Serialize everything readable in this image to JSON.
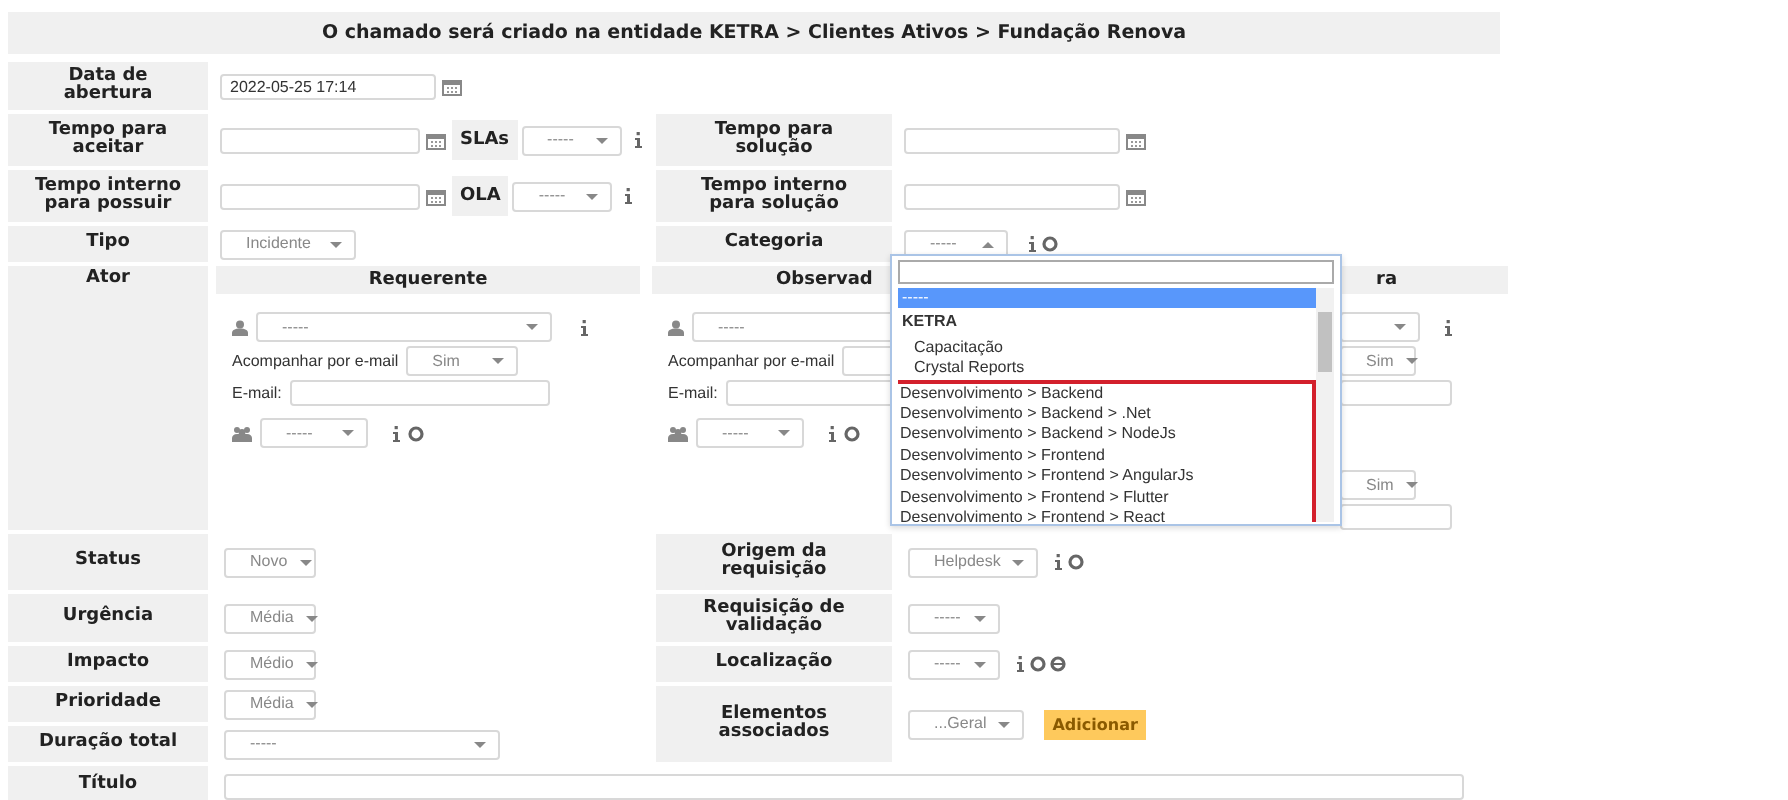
{
  "banner": "O chamado será criado na entidade KETRA > Clientes Ativos > Fundação Renova",
  "opening": {
    "label": "Data de abertura",
    "value": "2022-05-25 17:14"
  },
  "time_rows": [
    {
      "label": "Tempo para aceitar",
      "tag": "SLAs",
      "select": "-----",
      "right_label": "Tempo para solução"
    },
    {
      "label": "Tempo interno para possuir",
      "tag": "OLA",
      "select": "-----",
      "right_label": "Tempo interno para solução"
    }
  ],
  "type": {
    "label": "Tipo",
    "value": "Incidente"
  },
  "category": {
    "label": "Categoria",
    "value": "-----",
    "expanded": true
  },
  "actors": {
    "label": "Ator",
    "columns": [
      {
        "heading": "Requerente",
        "user_select": "-----",
        "follow_label": "Acompanhar por e-mail",
        "follow_value": "Sim",
        "email_label": "E-mail:",
        "group_select": "-----"
      },
      {
        "heading": "Observad",
        "user_select": "-----",
        "follow_label": "Acompanhar por e-mail",
        "email_label": "E-mail:",
        "group_select": "-----"
      },
      {
        "heading": "ra",
        "follow_values": [
          "Sim",
          "Sim"
        ]
      }
    ]
  },
  "left_fields": [
    {
      "label": "Status",
      "value": "Novo",
      "kind": "short"
    },
    {
      "label": "Urgência",
      "value": "Média",
      "kind": "short"
    },
    {
      "label": "Impacto",
      "value": "Médio",
      "kind": "short"
    },
    {
      "label": "Prioridade",
      "value": "Média",
      "kind": "short"
    },
    {
      "label": "Duração total",
      "value": "-----",
      "kind": "wide"
    }
  ],
  "right_fields": [
    {
      "label": "Origem da requisição",
      "value": "Helpdesk",
      "kind": "actions"
    },
    {
      "label": "Requisição de validação",
      "value": "-----",
      "kind": "plain"
    },
    {
      "label": "Localização",
      "value": "-----",
      "kind": "location"
    },
    {
      "label": "Elementos associados",
      "value": "...Geral",
      "kind": "button",
      "button": "Adicionar"
    }
  ],
  "title_label": "Título",
  "dropdown": {
    "options": [
      {
        "text": "-----",
        "kind": "empty",
        "selected": true,
        "outlined": false
      },
      {
        "text": "KETRA",
        "kind": "group",
        "selected": false,
        "outlined": false
      },
      {
        "text": "Capacitação",
        "kind": "option",
        "selected": false,
        "outlined": false
      },
      {
        "text": "Crystal Reports",
        "kind": "option",
        "selected": false,
        "outlined": false
      },
      {
        "text": "Desenvolvimento > Backend",
        "kind": "option",
        "selected": false,
        "outlined": true
      },
      {
        "text": "Desenvolvimento > Backend > .Net",
        "kind": "option",
        "selected": false,
        "outlined": true
      },
      {
        "text": "Desenvolvimento > Backend > NodeJs",
        "kind": "option",
        "selected": false,
        "outlined": true
      },
      {
        "text": "Desenvolvimento > Frontend",
        "kind": "option",
        "selected": false,
        "outlined": true
      },
      {
        "text": "Desenvolvimento > Frontend > AngularJs",
        "kind": "option",
        "selected": false,
        "outlined": true
      },
      {
        "text": "Desenvolvimento > Frontend > Flutter",
        "kind": "option",
        "selected": false,
        "outlined": true
      },
      {
        "text": "Desenvolvimento > Frontend > React",
        "kind": "option",
        "selected": false,
        "outlined": true
      }
    ]
  }
}
